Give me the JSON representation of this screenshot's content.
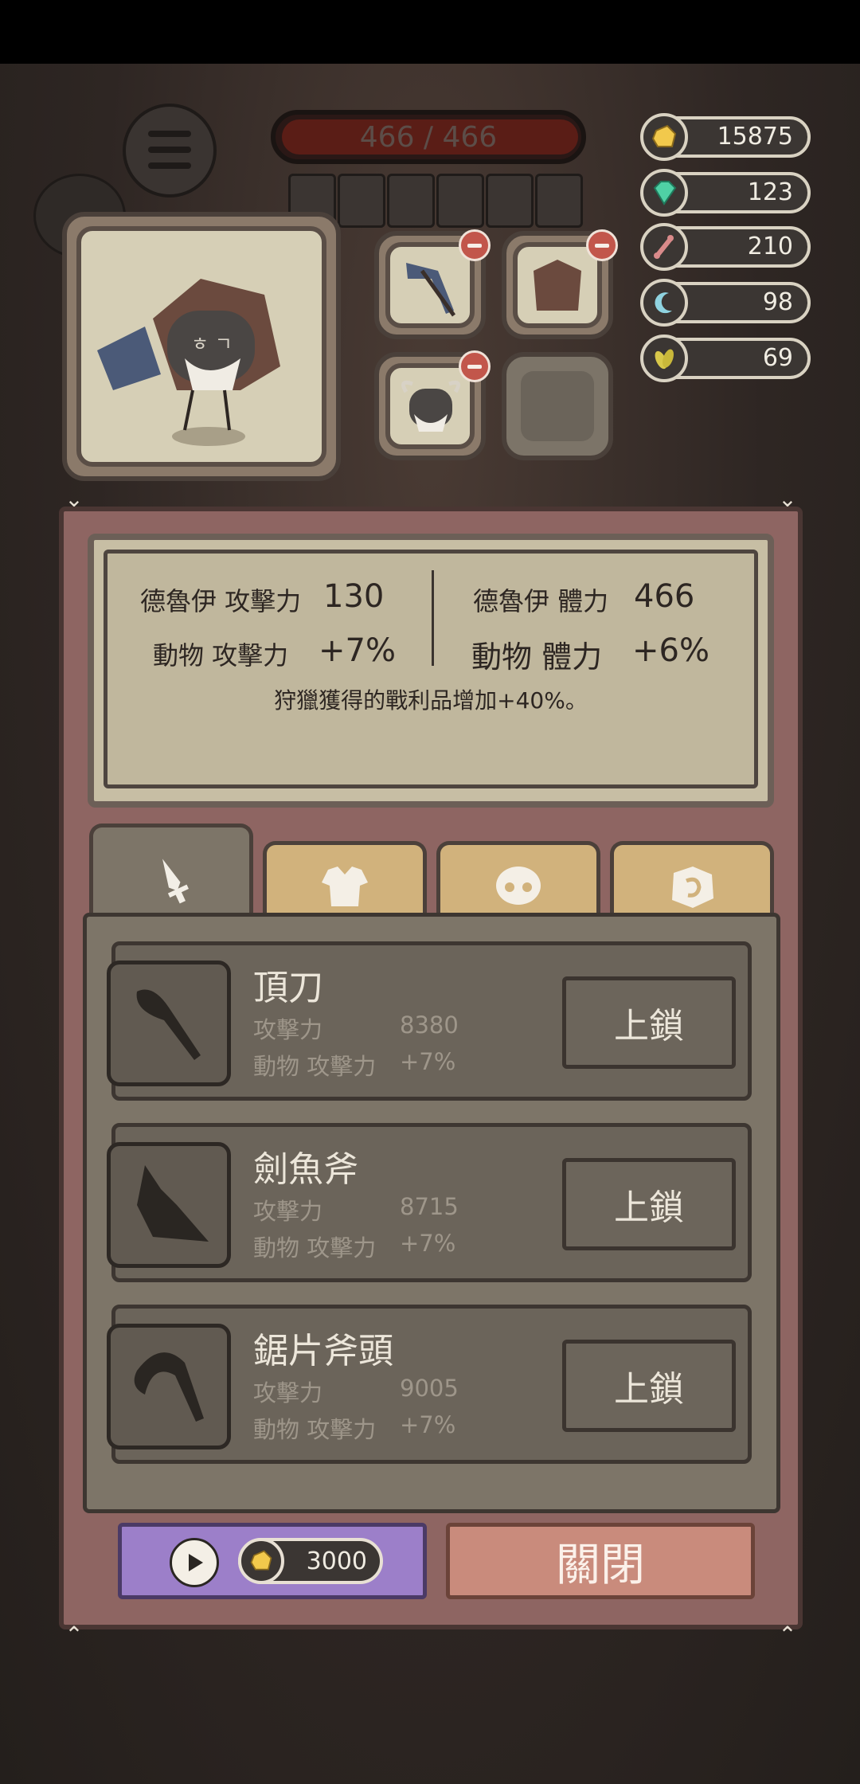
{
  "hud": {
    "hp_text": "466 / 466",
    "hp_fraction": 1.0
  },
  "resources": [
    {
      "name": "gold-nugget-icon",
      "value": "15875",
      "color": "#f2c94c"
    },
    {
      "name": "gem-icon",
      "value": "123",
      "color": "#4fd1a5"
    },
    {
      "name": "bone-icon",
      "value": "210",
      "color": "#d98a8a"
    },
    {
      "name": "moon-icon",
      "value": "98",
      "color": "#8fd3e0"
    },
    {
      "name": "leaf-icon",
      "value": "69",
      "color": "#d8c84a"
    }
  ],
  "stats": {
    "druid_attack_label": "德魯伊 攻擊力",
    "druid_attack_value": "130",
    "druid_hp_label": "德魯伊 體力",
    "druid_hp_value": "466",
    "animal_attack_label": "動物 攻擊力",
    "animal_attack_value": "+7%",
    "animal_hp_label": "動物 體力",
    "animal_hp_value": "+6%",
    "note": "狩獵獲得的戰利品增加+40%。"
  },
  "tabs": [
    {
      "icon": "sword-icon",
      "active": true
    },
    {
      "icon": "armor-icon",
      "active": false
    },
    {
      "icon": "skull-mask-icon",
      "active": false
    },
    {
      "icon": "stone-rune-icon",
      "active": false
    }
  ],
  "items": [
    {
      "name": "頂刀",
      "attack_label": "攻擊力",
      "attack_value": "8380",
      "animal_label": "動物 攻擊力",
      "animal_value": "+7%",
      "button": "上鎖"
    },
    {
      "name": "劍魚斧",
      "attack_label": "攻擊力",
      "attack_value": "8715",
      "animal_label": "動物 攻擊力",
      "animal_value": "+7%",
      "button": "上鎖"
    },
    {
      "name": "鋸片斧頭",
      "attack_label": "攻擊力",
      "attack_value": "9005",
      "animal_label": "動物 攻擊力",
      "animal_value": "+7%",
      "button": "上鎖"
    }
  ],
  "footer": {
    "ad_cost": "3000",
    "close_label": "關閉"
  }
}
